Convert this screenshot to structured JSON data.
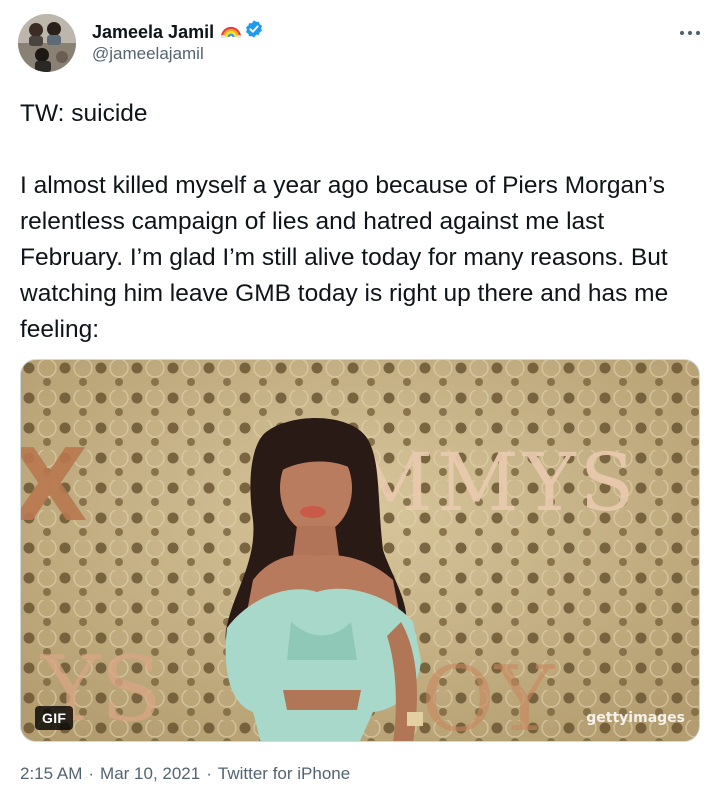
{
  "author": {
    "display_name": "Jameela Jamil",
    "handle": "@jameelajamil",
    "icons": [
      "rainbow-emoji-icon",
      "verified-badge-icon"
    ],
    "avatar": "avatar"
  },
  "menu": {
    "icon": "more-options-icon"
  },
  "tweet": {
    "line1": "TW: suicide",
    "body": "I almost killed myself a year ago because of Piers Morgan’s relentless campaign of lies and hatred against me last February. I’m glad I’m still alive today for many reasons. But watching him leave GMB today is right up there and has me feeling:"
  },
  "media": {
    "type": "gif",
    "badge": "GIF",
    "watermark": "gettyimages",
    "backdrop_text": "MMYS"
  },
  "meta": {
    "time": "2:15 AM",
    "separator": "·",
    "date": "Mar 10, 2021",
    "source": "Twitter for iPhone"
  },
  "colors": {
    "verified": "#1d9bf0",
    "text_primary": "#0f1419",
    "text_secondary": "#536471",
    "border": "#cfd9de"
  }
}
